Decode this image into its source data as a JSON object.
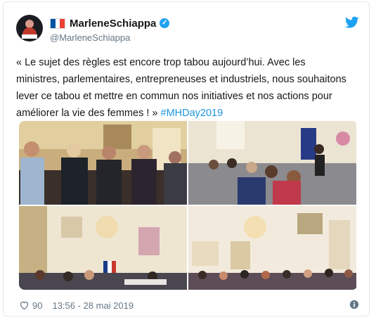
{
  "user": {
    "display_name": "MarleneSchiappa",
    "handle": "@MarleneSchiappa"
  },
  "tweet": {
    "text_main": "« Le sujet des règles est encore trop tabou aujourd’hui. Avec les ministres, parlementaires, entrepreneuses et industriels, nous souhaitons lever ce tabou et mettre en commun nos initiatives et nos actions pour améliorer la vie des femmes ! » ",
    "hashtag": "#MHDay2019"
  },
  "footer": {
    "likes": "90",
    "timestamp": "13:56 - 28 mai 2019"
  },
  "icons": {
    "bird": "twitter-bird-icon",
    "verified": "verified-badge-icon",
    "heart": "heart-icon",
    "info": "info-icon",
    "flag": "france-flag-icon"
  },
  "colors": {
    "accent": "#1da1f2",
    "hashtag": "#1b95e0",
    "meta_text": "#657786"
  }
}
